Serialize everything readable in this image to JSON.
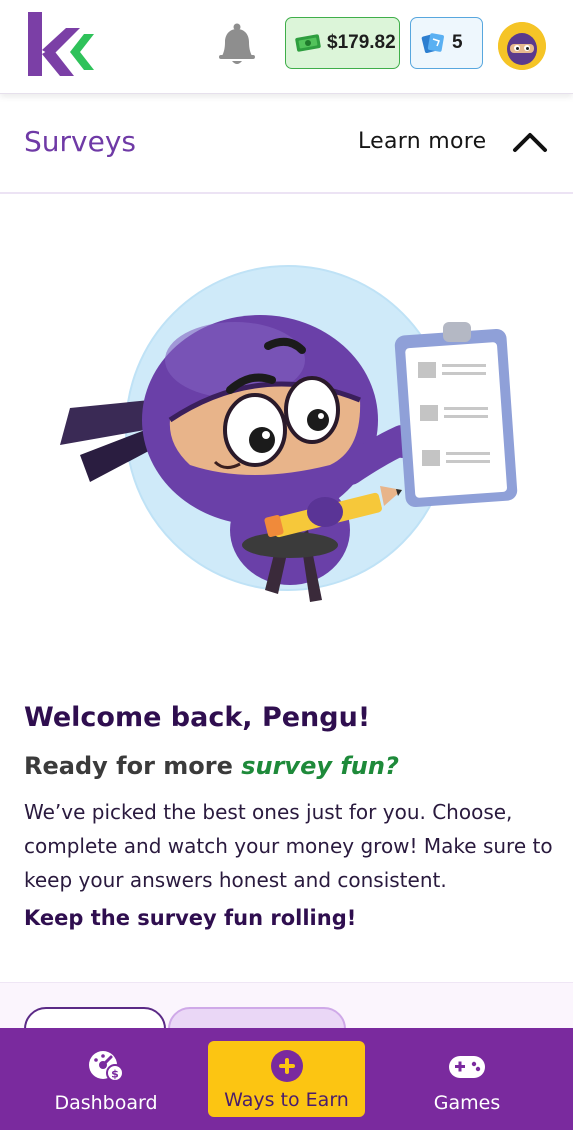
{
  "header": {
    "cash_balance": "$179.82",
    "gem_count": "5",
    "icons": [
      "logo-icon",
      "bell-icon",
      "cash-icon",
      "gem-icon",
      "avatar"
    ]
  },
  "section": {
    "title": "Surveys",
    "learn_more_label": "Learn more"
  },
  "intro": {
    "welcome": "Welcome back, Pengu!",
    "ready_prefix": "Ready for more ",
    "ready_accent": "survey fun?",
    "body": "We’ve picked the best ones just for you. Choose, complete and watch your money grow! Make sure to keep your answers honest and consistent.",
    "cta": "Keep the survey fun rolling!"
  },
  "nav": {
    "items": [
      {
        "label": "Dashboard",
        "icon": "dashboard-icon"
      },
      {
        "label": "Ways to Earn",
        "icon": "plus-circle-icon",
        "active": true
      },
      {
        "label": "Games",
        "icon": "gamepad-icon"
      }
    ]
  },
  "colors": {
    "brand_purple": "#7a2a9e",
    "title_purple": "#6f3aa6",
    "accent_green": "#1e8a3a",
    "active_yellow": "#fcc512",
    "cash_bg": "#dcf5d9",
    "gem_bg": "#eef7fd"
  }
}
